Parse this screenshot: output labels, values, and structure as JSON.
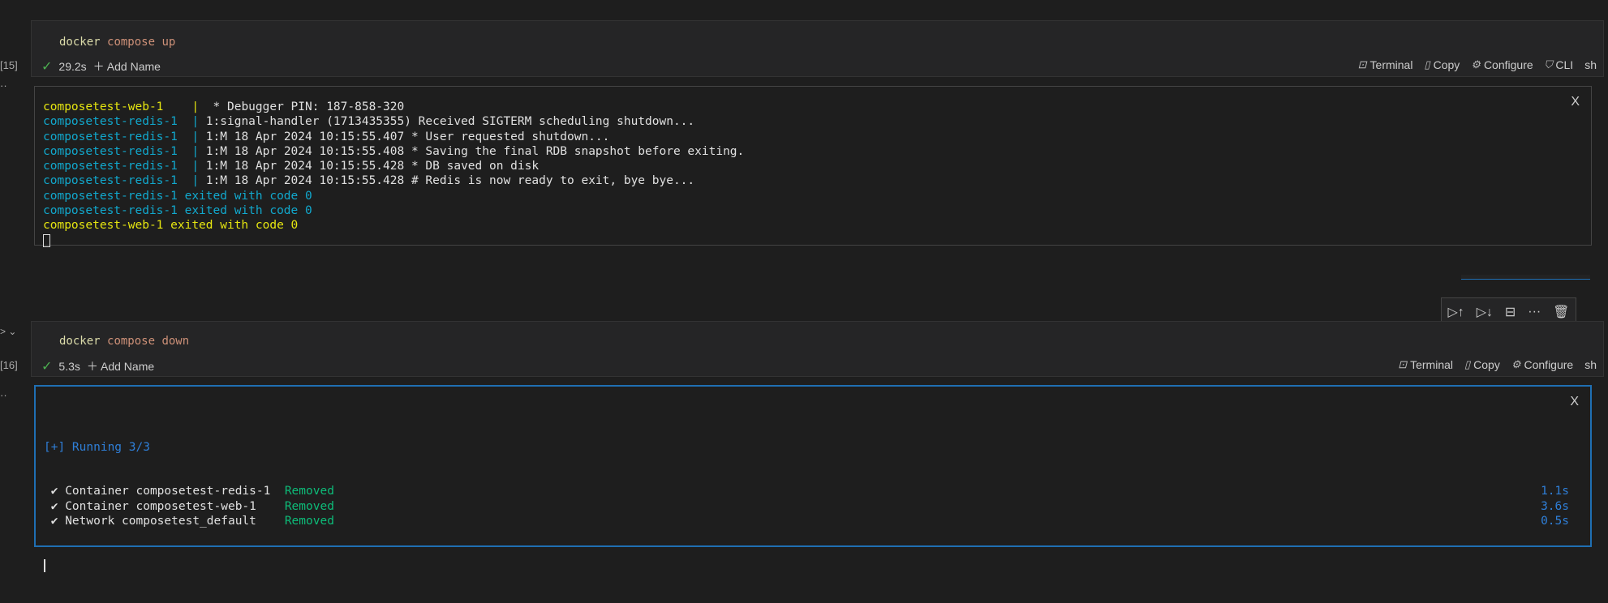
{
  "cells": [
    {
      "exec_count": "[15]",
      "command": {
        "program": "docker",
        "args": "compose up"
      },
      "duration": "29.2s",
      "add_name": "Add Name",
      "actions": [
        "Terminal",
        "Copy",
        "Configure",
        "CLI",
        "sh"
      ]
    },
    {
      "exec_count": "[16]",
      "command": {
        "program": "docker",
        "args": "compose down"
      },
      "duration": "5.3s",
      "add_name": "Add Name",
      "actions": [
        "Terminal",
        "Copy",
        "Configure",
        "sh"
      ]
    }
  ],
  "output1": {
    "lines": [
      {
        "prefix": "composetest-web-1    |",
        "text": "  * Debugger PIN: 187-858-320",
        "color": "yellow"
      },
      {
        "prefix": "composetest-redis-1  |",
        "text": " 1:signal-handler (1713435355) Received SIGTERM scheduling shutdown...",
        "color": "cyan"
      },
      {
        "prefix": "composetest-redis-1  |",
        "text": " 1:M 18 Apr 2024 10:15:55.407 * User requested shutdown...",
        "color": "cyan"
      },
      {
        "prefix": "composetest-redis-1  |",
        "text": " 1:M 18 Apr 2024 10:15:55.408 * Saving the final RDB snapshot before exiting.",
        "color": "cyan"
      },
      {
        "prefix": "composetest-redis-1  |",
        "text": " 1:M 18 Apr 2024 10:15:55.428 * DB saved on disk",
        "color": "cyan"
      },
      {
        "prefix": "composetest-redis-1  |",
        "text": " 1:M 18 Apr 2024 10:15:55.428 # Redis is now ready to exit, bye bye...",
        "color": "cyan"
      },
      {
        "prefix": "composetest-redis-1 exited with code 0",
        "text": "",
        "color": "cyan"
      },
      {
        "prefix": "composetest-redis-1 exited with code 0",
        "text": "",
        "color": "cyan"
      },
      {
        "prefix": "composetest-web-1 exited with code 0",
        "text": "",
        "color": "yellow"
      }
    ]
  },
  "output2": {
    "header": "[+] Running 3/3",
    "rows": [
      {
        "label": " ✔ Container composetest-redis-1  ",
        "status": "Removed",
        "time": "1.1s"
      },
      {
        "label": " ✔ Container composetest-web-1    ",
        "status": "Removed",
        "time": "3.6s"
      },
      {
        "label": " ✔ Network composetest_default    ",
        "status": "Removed",
        "time": "0.5s"
      }
    ]
  },
  "close_glyph": "X",
  "colors": {
    "yellow": "#e5e510",
    "cyan": "#11a8cd",
    "blue": "#2f7fd8",
    "green": "#0dbc79",
    "focus_border": "#1f6fb3"
  }
}
